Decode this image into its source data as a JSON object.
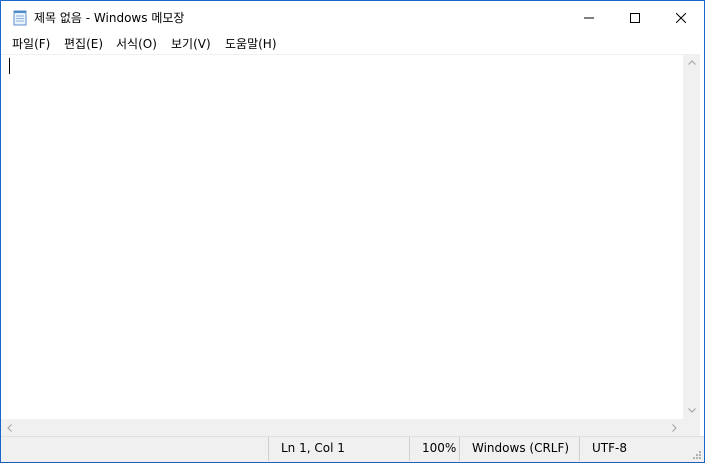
{
  "window": {
    "title": "제목 없음 - Windows 메모장"
  },
  "icons": {
    "app": "notepad-icon",
    "minimize": "minimize-icon",
    "maximize": "maximize-icon",
    "close": "close-icon"
  },
  "menubar": {
    "items": [
      {
        "label": "파일(F)"
      },
      {
        "label": "편집(E)"
      },
      {
        "label": "서식(O)"
      },
      {
        "label": "보기(V)"
      },
      {
        "label": "도움말(H)"
      }
    ]
  },
  "editor": {
    "content": ""
  },
  "statusbar": {
    "position": "Ln 1, Col 1",
    "zoom": "100%",
    "line_ending": "Windows (CRLF)",
    "encoding": "UTF-8"
  },
  "colors": {
    "window_border": "#1b66c9",
    "chrome_bg": "#f0f0f0",
    "desktop": "#1a5fb4"
  }
}
